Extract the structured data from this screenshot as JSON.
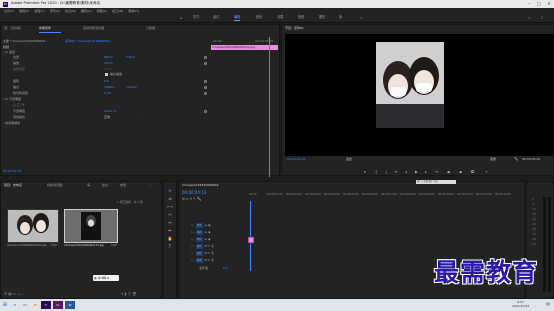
{
  "titlebar": {
    "app": "Adobe Premiere Pro 2020 - D:\\最需教育\\素材\\未命名",
    "controls": [
      "–",
      "□",
      "✕"
    ]
  },
  "menubar": [
    "文件(F)",
    "编辑(E)",
    "剪辑(C)",
    "序列(S)",
    "标记(M)",
    "图形(G)",
    "视图(V)",
    "窗口(W)",
    "帮助(H)"
  ],
  "workspaces": [
    "学习",
    "组件",
    "编辑",
    "颜色",
    "效果",
    "音频",
    "图形",
    "库"
  ],
  "workspace_active": "编辑",
  "effect_controls": {
    "tabs": [
      "源：(无剪辑)",
      "效果控件",
      "音频剪辑混合器",
      "元数据"
    ],
    "clip_label": "主要 * mmexport163490090…",
    "seq_label": "序列01 * mmexport16349009…",
    "section": "视频",
    "motion": "运动",
    "params": [
      {
        "name": "位置",
        "v1": "960.0",
        "v2": "540.0"
      },
      {
        "name": "缩放",
        "v1": "100.0",
        "v2": ""
      },
      {
        "name": "缩放宽度",
        "v1": "100.0",
        "v2": ""
      },
      {
        "name": "等比缩放",
        "v1": "",
        "v2": ""
      },
      {
        "name": "旋转",
        "v1": "0.0",
        "v2": ""
      },
      {
        "name": "锚点",
        "v1": "1080.0",
        "v2": "1440.0"
      },
      {
        "name": "防闪烁滤镜",
        "v1": "0.00",
        "v2": ""
      },
      {
        "name": "不透明度",
        "v1": "",
        "v2": ""
      },
      {
        "name": "不透明度",
        "v1": "100.0 %",
        "v2": ""
      },
      {
        "name": "混合模式",
        "v1": "正常",
        "v2": ""
      },
      {
        "name": "时间重映射",
        "v1": "",
        "v2": ""
      }
    ],
    "clip_bar": "mmexport1634900904102.jpg",
    "time_start": ":00:00",
    "time_end": "00:00:05:00",
    "timecode": "00:00:04:12"
  },
  "program": {
    "tab": "节目：序列01",
    "timecode": "00:00:04:12",
    "fit": "适合",
    "duration": "00:00:05:00",
    "quality": "完整"
  },
  "project": {
    "tabs": [
      "项目：未命名",
      "媒体浏览器",
      "库",
      "信息",
      "效果"
    ],
    "items_label": "1 项已选择，共 2 项",
    "items": [
      {
        "name": "mmexport1634900904102.jpg",
        "dur": "5:00"
      },
      {
        "name": "mmexport1634900922113.jpg",
        "dur": "5:00"
      }
    ]
  },
  "timeline": {
    "tab": "mmexport16349009041",
    "timecode": "00:00:04:12",
    "ruler": [
      "00:00",
      "00:00:01:00",
      "00:00:02:00",
      "00:00:03:00",
      "00:00:04:00",
      "00:00:05:00",
      "00:00:06:00",
      "00:00:07:00",
      "00:00:08:00",
      "00:00:09:00",
      "00:00:10:00",
      "00:00:11:00",
      "00:00:12:00",
      "00:00:13:00",
      "00:00:14:00"
    ],
    "tracks": [
      "V3",
      "V2",
      "V1",
      "A1",
      "A2",
      "A3"
    ],
    "master": "主声道",
    "master_val": "0.0"
  },
  "overlay": {
    "source_tag": "源：(无剪辑) 节目"
  },
  "watermark": "最需教育",
  "taskbar": {
    "time": "9:07",
    "date": "2021/10/22"
  },
  "colors": {
    "accent": "#3d8bff",
    "clip_pink": "#e58ee0",
    "dark_bg": "#1d1d1d",
    "panel_bg": "#232323",
    "watermark": "#2a1aa8"
  }
}
